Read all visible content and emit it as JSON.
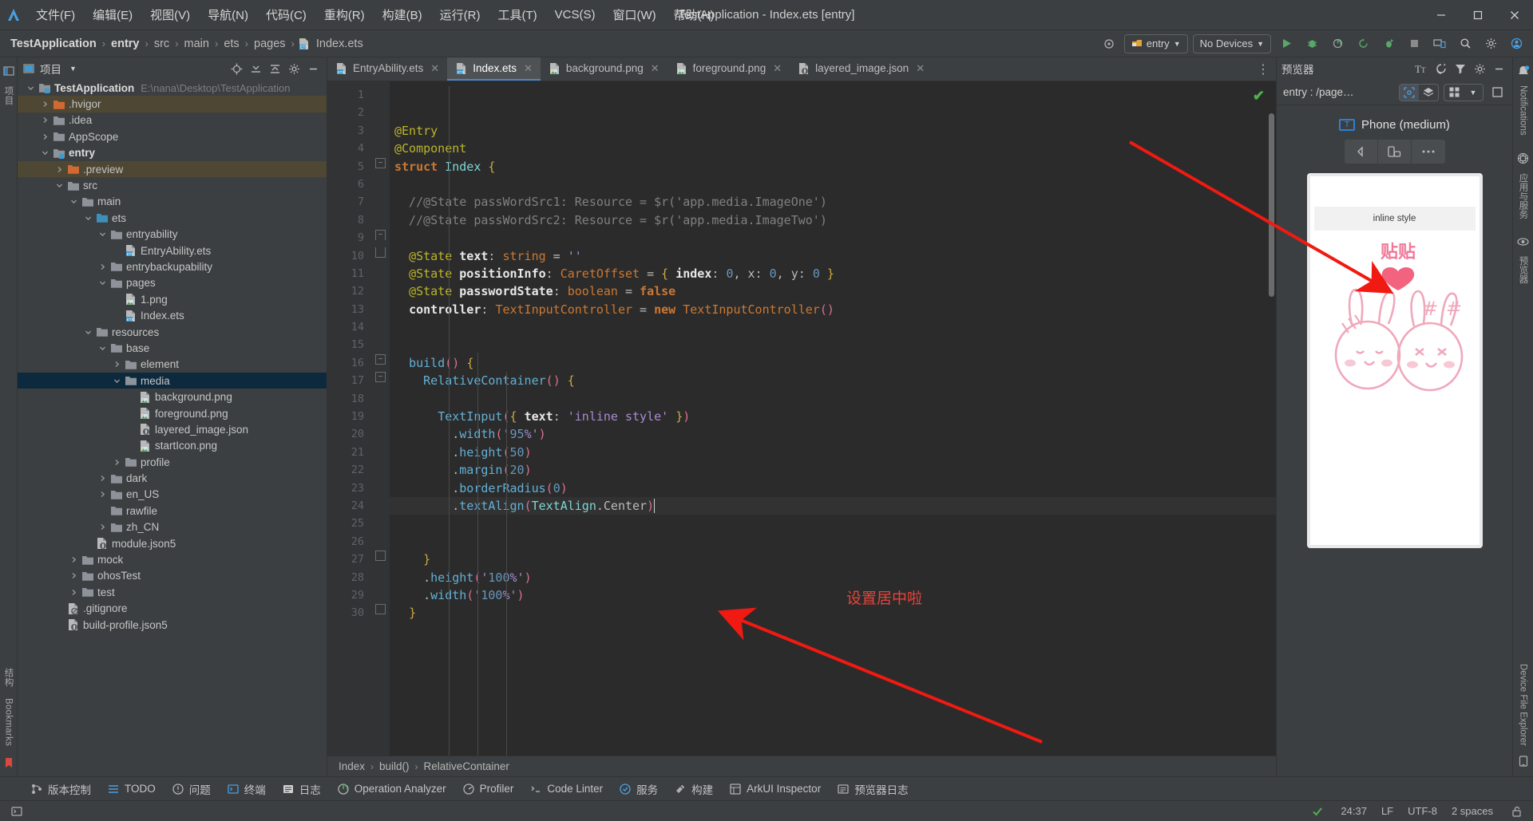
{
  "window": {
    "title": "TestApplication - Index.ets [entry]",
    "menu": [
      "文件(F)",
      "编辑(E)",
      "视图(V)",
      "导航(N)",
      "代码(C)",
      "重构(R)",
      "构建(B)",
      "运行(R)",
      "工具(T)",
      "VCS(S)",
      "窗口(W)",
      "帮助(H)"
    ],
    "controls": {
      "minimize": "—",
      "maximize": "▢",
      "close": "✕"
    }
  },
  "breadcrumb": {
    "items": [
      "TestApplication",
      "entry",
      "src",
      "main",
      "ets",
      "pages",
      "Index.ets"
    ],
    "separator": "›"
  },
  "navbar": {
    "target_label": "entry",
    "device_label": "No Devices",
    "icons": [
      "target-icon",
      "run-icon",
      "debug-icon",
      "profile-icon",
      "sync-icon",
      "attach-icon",
      "stop-icon",
      "device-manager-icon",
      "search-icon",
      "settings-icon",
      "account-icon"
    ]
  },
  "project_panel": {
    "title": "项目",
    "header_icons": [
      "locate-icon",
      "expand-all-icon",
      "collapse-all-icon",
      "settings-icon",
      "hide-icon"
    ],
    "tree": [
      {
        "depth": 0,
        "arrow": "down",
        "icon": "module-folder-icon",
        "label": "TestApplication",
        "bold": true,
        "path": "E:\\nana\\Desktop\\TestApplication",
        "state": "normal"
      },
      {
        "depth": 1,
        "arrow": "right",
        "icon": "excluded-folder-icon",
        "label": ".hvigor",
        "state": "hl"
      },
      {
        "depth": 1,
        "arrow": "right",
        "icon": "folder-icon",
        "label": ".idea",
        "state": "normal"
      },
      {
        "depth": 1,
        "arrow": "right",
        "icon": "folder-icon",
        "label": "AppScope",
        "state": "normal"
      },
      {
        "depth": 1,
        "arrow": "down",
        "icon": "module-folder-icon",
        "label": "entry",
        "bold": true,
        "state": "normal"
      },
      {
        "depth": 2,
        "arrow": "right",
        "icon": "excluded-folder-icon",
        "label": ".preview",
        "state": "hl"
      },
      {
        "depth": 2,
        "arrow": "down",
        "icon": "folder-icon",
        "label": "src",
        "state": "normal"
      },
      {
        "depth": 3,
        "arrow": "down",
        "icon": "folder-icon",
        "label": "main",
        "state": "normal"
      },
      {
        "depth": 4,
        "arrow": "down",
        "icon": "source-folder-icon",
        "label": "ets",
        "state": "normal"
      },
      {
        "depth": 5,
        "arrow": "down",
        "icon": "folder-icon",
        "label": "entryability",
        "state": "normal"
      },
      {
        "depth": 6,
        "arrow": "none",
        "icon": "ets-file-icon",
        "label": "EntryAbility.ets",
        "state": "normal"
      },
      {
        "depth": 5,
        "arrow": "right",
        "icon": "folder-icon",
        "label": "entrybackupability",
        "state": "normal"
      },
      {
        "depth": 5,
        "arrow": "down",
        "icon": "folder-icon",
        "label": "pages",
        "state": "normal"
      },
      {
        "depth": 6,
        "arrow": "none",
        "icon": "image-file-icon",
        "label": "1.png",
        "state": "normal"
      },
      {
        "depth": 6,
        "arrow": "none",
        "icon": "ets-file-icon",
        "label": "Index.ets",
        "state": "normal"
      },
      {
        "depth": 4,
        "arrow": "down",
        "icon": "folder-icon",
        "label": "resources",
        "state": "normal"
      },
      {
        "depth": 5,
        "arrow": "down",
        "icon": "folder-icon",
        "label": "base",
        "state": "normal"
      },
      {
        "depth": 6,
        "arrow": "right",
        "icon": "folder-icon",
        "label": "element",
        "state": "normal"
      },
      {
        "depth": 6,
        "arrow": "down",
        "icon": "folder-icon",
        "label": "media",
        "state": "sel"
      },
      {
        "depth": 7,
        "arrow": "none",
        "icon": "image-file-icon",
        "label": "background.png",
        "state": "normal"
      },
      {
        "depth": 7,
        "arrow": "none",
        "icon": "image-file-icon",
        "label": "foreground.png",
        "state": "normal"
      },
      {
        "depth": 7,
        "arrow": "none",
        "icon": "json-file-icon",
        "label": "layered_image.json",
        "state": "normal"
      },
      {
        "depth": 7,
        "arrow": "none",
        "icon": "image-file-icon",
        "label": "startIcon.png",
        "state": "normal"
      },
      {
        "depth": 6,
        "arrow": "right",
        "icon": "folder-icon",
        "label": "profile",
        "state": "normal"
      },
      {
        "depth": 5,
        "arrow": "right",
        "icon": "folder-icon",
        "label": "dark",
        "state": "normal"
      },
      {
        "depth": 5,
        "arrow": "right",
        "icon": "folder-icon",
        "label": "en_US",
        "state": "normal"
      },
      {
        "depth": 5,
        "arrow": "none",
        "icon": "folder-icon",
        "label": "rawfile",
        "state": "normal"
      },
      {
        "depth": 5,
        "arrow": "right",
        "icon": "folder-icon",
        "label": "zh_CN",
        "state": "normal"
      },
      {
        "depth": 4,
        "arrow": "none",
        "icon": "json-file-icon",
        "label": "module.json5",
        "state": "normal"
      },
      {
        "depth": 3,
        "arrow": "right",
        "icon": "folder-icon",
        "label": "mock",
        "state": "normal"
      },
      {
        "depth": 3,
        "arrow": "right",
        "icon": "folder-icon",
        "label": "ohosTest",
        "state": "normal"
      },
      {
        "depth": 3,
        "arrow": "right",
        "icon": "folder-icon",
        "label": "test",
        "state": "normal"
      },
      {
        "depth": 2,
        "arrow": "none",
        "icon": "gitignore-file-icon",
        "label": ".gitignore",
        "state": "normal"
      },
      {
        "depth": 2,
        "arrow": "none",
        "icon": "json-file-icon",
        "label": "build-profile.json5",
        "state": "normal"
      }
    ]
  },
  "editor": {
    "tabs": [
      {
        "label": "EntryAbility.ets",
        "icon": "ets-file-icon",
        "active": false
      },
      {
        "label": "Index.ets",
        "icon": "ets-file-icon",
        "active": true
      },
      {
        "label": "background.png",
        "icon": "image-file-icon",
        "active": false
      },
      {
        "label": "foreground.png",
        "icon": "image-file-icon",
        "active": false
      },
      {
        "label": "layered_image.json",
        "icon": "json-file-icon",
        "active": false
      }
    ],
    "tab_close_glyph": "✕",
    "more_glyph": "⋮",
    "inspection_ok": "✔",
    "first_line": 1,
    "last_line": 30,
    "lines": [
      {
        "n": 1,
        "text": ""
      },
      {
        "n": 2,
        "text": ""
      },
      {
        "n": 3,
        "text": "@Entry"
      },
      {
        "n": 4,
        "text": "@Component"
      },
      {
        "n": 5,
        "text": "struct Index {"
      },
      {
        "n": 6,
        "text": ""
      },
      {
        "n": 7,
        "text": "  //@State passWordSrc1: Resource = $r('app.media.ImageOne')"
      },
      {
        "n": 8,
        "text": "  //@State passWordSrc2: Resource = $r('app.media.ImageTwo')"
      },
      {
        "n": 9,
        "text": ""
      },
      {
        "n": 10,
        "text": "  @State text: string = ''"
      },
      {
        "n": 11,
        "text": "  @State positionInfo: CaretOffset = { index: 0, x: 0, y: 0 }"
      },
      {
        "n": 12,
        "text": "  @State passwordState: boolean = false"
      },
      {
        "n": 13,
        "text": "  controller: TextInputController = new TextInputController()"
      },
      {
        "n": 14,
        "text": ""
      },
      {
        "n": 15,
        "text": ""
      },
      {
        "n": 16,
        "text": "  build() {"
      },
      {
        "n": 17,
        "text": "    RelativeContainer() {"
      },
      {
        "n": 18,
        "text": ""
      },
      {
        "n": 19,
        "text": "      TextInput({ text: 'inline style' })"
      },
      {
        "n": 20,
        "text": "        .width('95%')"
      },
      {
        "n": 21,
        "text": "        .height(50)"
      },
      {
        "n": 22,
        "text": "        .margin(20)"
      },
      {
        "n": 23,
        "text": "        .borderRadius(0)"
      },
      {
        "n": 24,
        "text": "        .textAlign(TextAlign.Center)"
      },
      {
        "n": 25,
        "text": ""
      },
      {
        "n": 26,
        "text": ""
      },
      {
        "n": 27,
        "text": "    }"
      },
      {
        "n": 28,
        "text": "    .height('100%')"
      },
      {
        "n": 29,
        "text": "    .width('100%')"
      },
      {
        "n": 30,
        "text": "  }"
      }
    ],
    "caret_line": 24,
    "structure_breadcrumb": [
      "Index",
      "build()",
      "RelativeContainer"
    ]
  },
  "preview": {
    "title": "预览器",
    "header_icons": [
      "font-size-icon",
      "refresh-icon",
      "filter-icon",
      "settings-icon",
      "hide-icon"
    ],
    "route": "entry : /page…",
    "toolbar_icons": [
      "inspector-icon",
      "layers-icon",
      "multi-device-icon",
      "chevron-down-icon",
      "frame-icon"
    ],
    "device_name": "Phone (medium)",
    "device_chip": "T",
    "device_controls": [
      "back-icon",
      "rotate-icon",
      "more-icon"
    ],
    "phone_input_text": "inline style",
    "sticker_text": "贴贴"
  },
  "left_rail": {
    "items": [
      "项目",
      "结构",
      "Bookmarks"
    ]
  },
  "right_rail": {
    "items": [
      "Notifications",
      "应用与服务",
      "预览器",
      "Device File Explorer"
    ]
  },
  "bottom_tools": [
    {
      "label": "版本控制",
      "icon": "vcs-icon"
    },
    {
      "label": "TODO",
      "icon": "todo-icon"
    },
    {
      "label": "问题",
      "icon": "problems-icon"
    },
    {
      "label": "终端",
      "icon": "terminal-icon"
    },
    {
      "label": "日志",
      "icon": "log-icon"
    },
    {
      "label": "Operation Analyzer",
      "icon": "analyzer-icon"
    },
    {
      "label": "Profiler",
      "icon": "profiler-icon"
    },
    {
      "label": "Code Linter",
      "icon": "linter-icon"
    },
    {
      "label": "服务",
      "icon": "services-icon"
    },
    {
      "label": "构建",
      "icon": "build-icon"
    },
    {
      "label": "ArkUI Inspector",
      "icon": "arkui-icon"
    },
    {
      "label": "预览器日志",
      "icon": "preview-log-icon"
    }
  ],
  "status_bar": {
    "left_icon": "terminal-toggle-icon",
    "caret": "24:37",
    "line_sep": "LF",
    "encoding": "UTF-8",
    "indent": "2 spaces",
    "lock_icon": "unlocked-icon",
    "inspection_icon": "inspection-ok-icon"
  },
  "annotations": {
    "center_note": "设置居中啦",
    "color": "#e8433a"
  }
}
